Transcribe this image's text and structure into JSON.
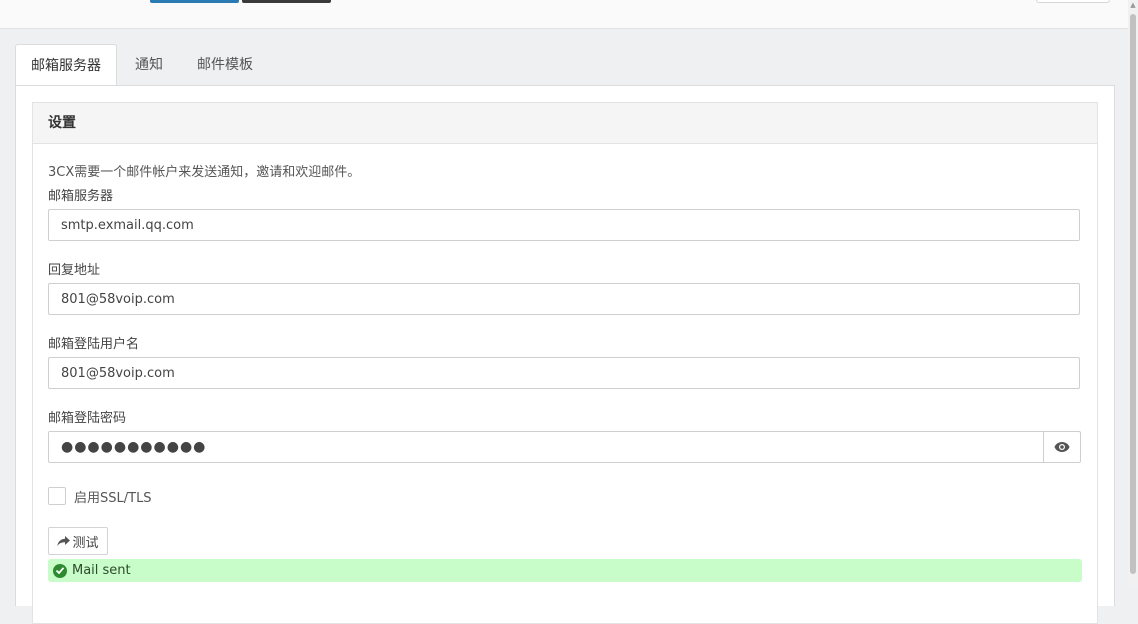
{
  "tabs": [
    {
      "label": "邮箱服务器",
      "active": true
    },
    {
      "label": "通知",
      "active": false
    },
    {
      "label": "邮件模板",
      "active": false
    }
  ],
  "panel": {
    "title": "设置",
    "intro": "3CX需要一个邮件帐户来发送通知，邀请和欢迎邮件。"
  },
  "form": {
    "mail_server_label": "邮箱服务器",
    "mail_server_value": "smtp.exmail.qq.com",
    "reply_to_label": "回复地址",
    "reply_to_value": "801@58voip.com",
    "username_label": "邮箱登陆用户名",
    "username_value": "801@58voip.com",
    "password_label": "邮箱登陆密码",
    "password_value": "●●●●●●●●●●●",
    "ssl_label": "启用SSL/TLS",
    "ssl_checked": false
  },
  "actions": {
    "test_label": "测试"
  },
  "status": {
    "message": "Mail sent",
    "color": "#c8fcc8"
  },
  "icons": {
    "eye": "eye-icon",
    "share": "share-arrow-icon",
    "ok": "check-circle-icon"
  }
}
